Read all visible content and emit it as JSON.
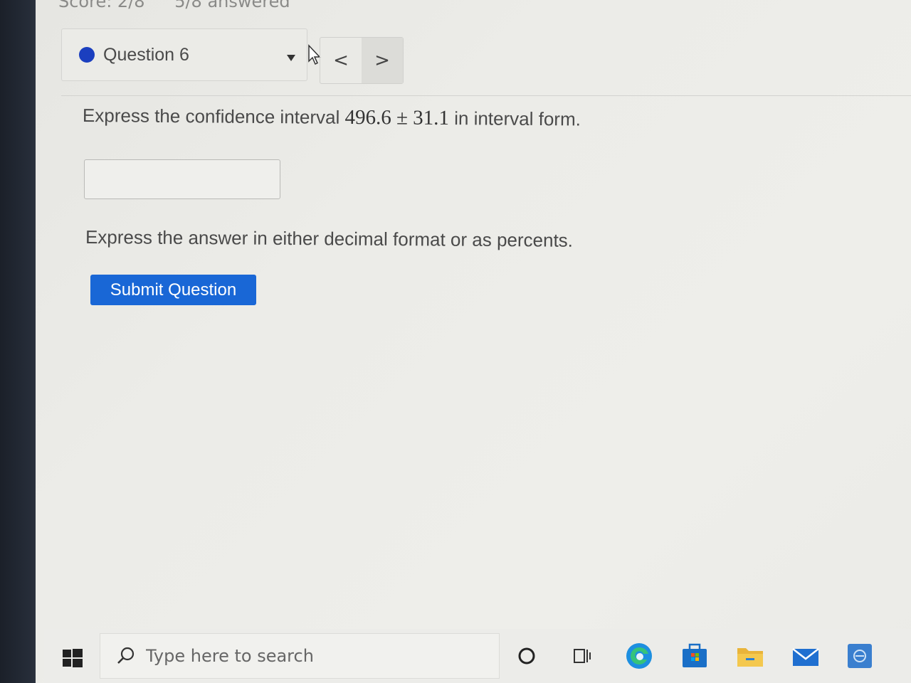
{
  "header": {
    "score": "Score: 2/8",
    "answered": "5/8 answered"
  },
  "question_nav": {
    "question_label": "Question 6",
    "prev_label": "<",
    "next_label": ">"
  },
  "question": {
    "prefix": "Express the confidence interval ",
    "value": "496.6 ± 31.1",
    "suffix": " in interval form.",
    "answer_value": "",
    "hint": "Express the answer in either decimal format or as percents.",
    "submit_label": "Submit Question"
  },
  "taskbar": {
    "search_placeholder": "Type here to search",
    "icons": [
      "windows-start-icon",
      "search-icon",
      "cortana-circle-icon",
      "task-view-icon",
      "edge-icon",
      "store-icon",
      "file-explorer-icon",
      "mail-icon",
      "app-icon"
    ]
  },
  "colors": {
    "accent": "#1967d6",
    "question_dot": "#1b3fbf"
  }
}
